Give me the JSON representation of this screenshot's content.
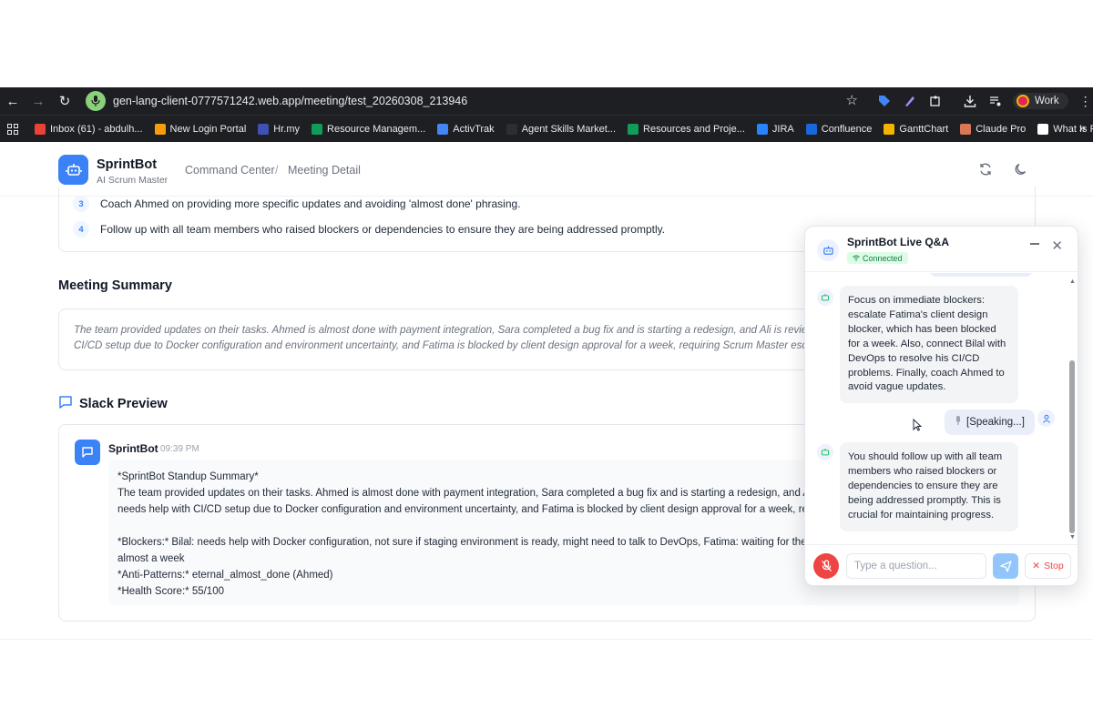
{
  "browser": {
    "url": "gen-lang-client-0777571242.web.app/meeting/test_20260308_213946",
    "profile_label": "Work",
    "bookmarks": [
      {
        "label": "Inbox (61) - abdulh...",
        "icon": "gmail-icon",
        "color": "#ea4335"
      },
      {
        "label": "New Login Portal",
        "icon": "portal-icon",
        "color": "#f59e0b"
      },
      {
        "label": "Hr.my",
        "icon": "hr-icon",
        "color": "#3f51b5"
      },
      {
        "label": "Resource Managem...",
        "icon": "sheets-icon",
        "color": "#0f9d58"
      },
      {
        "label": "ActivTrak",
        "icon": "activtrak-icon",
        "color": "#4285f4"
      },
      {
        "label": "Agent Skills Market...",
        "icon": "si-icon",
        "color": "#2d2e31"
      },
      {
        "label": "Resources and Proje...",
        "icon": "sheets-icon",
        "color": "#0f9d58"
      },
      {
        "label": "JIRA",
        "icon": "jira-icon",
        "color": "#2684ff"
      },
      {
        "label": "Confluence",
        "icon": "confluence-icon",
        "color": "#1868db"
      },
      {
        "label": "GanttChart",
        "icon": "gantt-icon",
        "color": "#f4b400"
      },
      {
        "label": "Claude Pro",
        "icon": "claude-icon",
        "color": "#d97757"
      },
      {
        "label": "What Is Python? | A...",
        "icon": "page-icon",
        "color": "#ffffff"
      }
    ]
  },
  "header": {
    "brand_name": "SprintBot",
    "brand_sub": "AI Scrum Master",
    "breadcrumb_1": "Command Center",
    "breadcrumb_sep": "/",
    "breadcrumb_2": "Meeting Detail"
  },
  "recommendations": [
    {
      "num": "3",
      "text": "Coach Ahmed on providing more specific updates and avoiding 'almost done' phrasing."
    },
    {
      "num": "4",
      "text": "Follow up with all team members who raised blockers or dependencies to ensure they are being addressed promptly."
    }
  ],
  "summary": {
    "title": "Meeting Summary",
    "text": "The team provided updates on their tasks. Ahmed is almost done with payment integration, Sara completed a bug fix and is starting a redesign, and Ali is reviewing API\nCI/CD setup due to Docker configuration and environment uncertainty, and Fatima is blocked by client design approval for a week, requiring Scrum Master escalation."
  },
  "slack": {
    "title": "Slack Preview",
    "sender": "SprintBot",
    "time": "09:39 PM",
    "lines": [
      "*SprintBot Standup Summary*",
      "The team provided updates on their tasks. Ahmed is almost done with payment integration, Sara completed a bug fix and is starting a redesign, and Ali is reviewing API changes. Bilal",
      "needs help with CI/CD setup due to Docker configuration and environment uncertainty, and Fatima is blocked by client design approval for a week, requiring Scrum Master escalation.",
      "",
      "*Blockers:* Bilal: needs help with Docker configuration, not sure if staging environment is ready, might need to talk to DevOps, Fatima: waiting for the client design approval for",
      "almost a week",
      "*Anti-Patterns:* eternal_almost_done (Ahmed)",
      "*Health Score:* 55/100"
    ]
  },
  "qa": {
    "title": "SprintBot Live Q&A",
    "status": "Connected",
    "messages": {
      "bot_1": "Focus on immediate blockers: escalate Fatima's client design blocker, which has been blocked for a week. Also, connect Bilal with DevOps to resolve his CI/CD problems. Finally, coach Ahmed to avoid vague updates.",
      "user_1": "[Speaking...]",
      "bot_2": "You should follow up with all team members who raised blockers or dependencies to ensure they are being addressed promptly. This is crucial for maintaining progress."
    },
    "input_placeholder": "Type a question...",
    "stop_label": "Stop"
  },
  "colors": {
    "accent": "#3b82f6",
    "connected_bg": "#dcfce7",
    "connected_text": "#15803d",
    "mic_active": "#ef4444"
  }
}
